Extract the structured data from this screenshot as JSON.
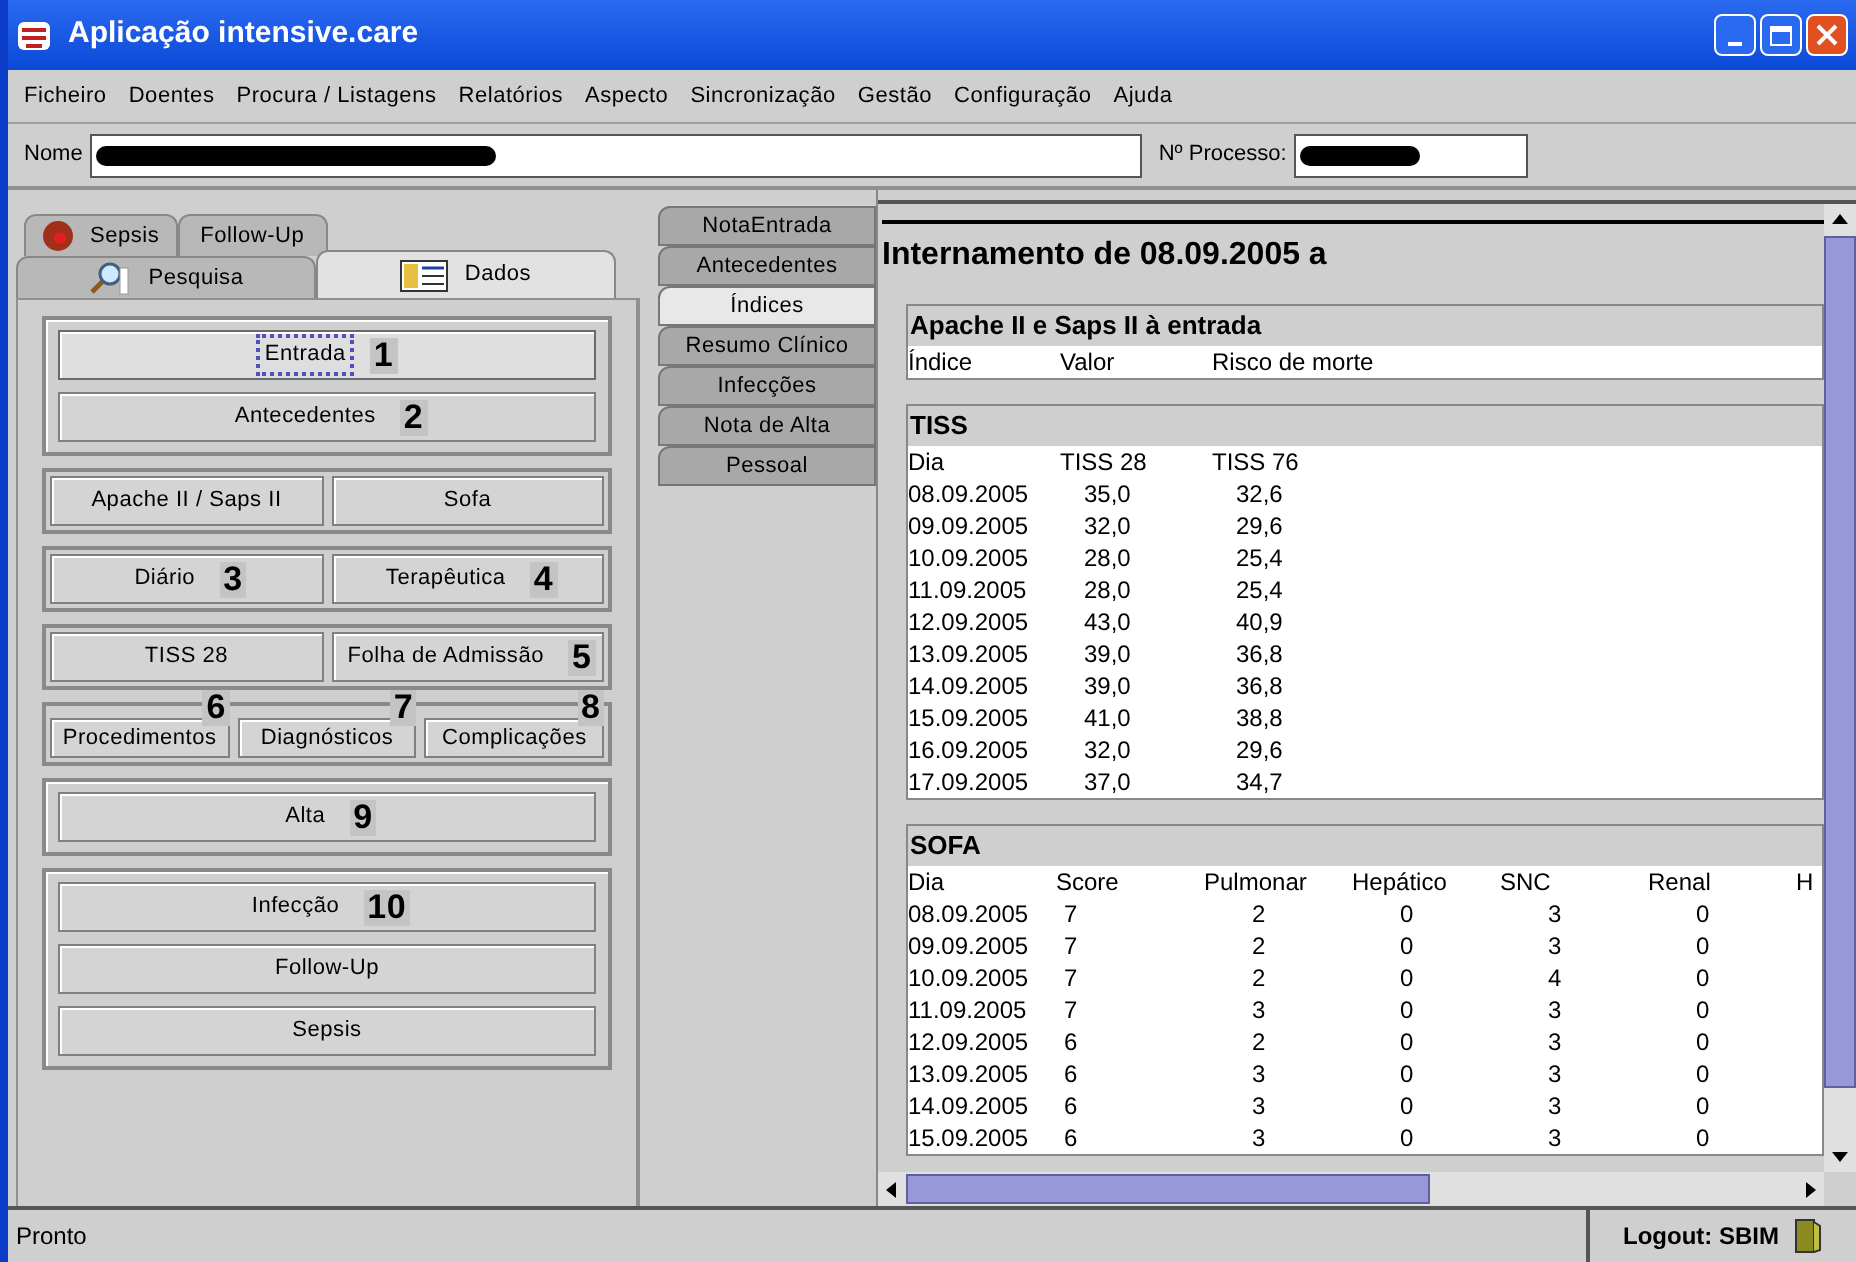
{
  "window": {
    "title": "Aplicação intensive.care"
  },
  "menu": [
    "Ficheiro",
    "Doentes",
    "Procura / Listagens",
    "Relatórios",
    "Aspecto",
    "Sincronização",
    "Gestão",
    "Configuração",
    "Ajuda"
  ],
  "patient": {
    "name_label": "Nome",
    "process_label": "Nº Processo:"
  },
  "left_tabs": [
    [
      {
        "label": "Sepsis",
        "kind": "sepsis",
        "selected": false
      },
      {
        "label": "Follow-Up",
        "kind": "plain",
        "selected": false
      }
    ],
    [
      {
        "label": "Pesquisa",
        "kind": "search",
        "selected": false
      },
      {
        "label": "Dados",
        "kind": "record",
        "selected": true
      }
    ]
  ],
  "button_groups": [
    {
      "kind": "stack",
      "buttons": [
        {
          "label": "Entrada",
          "number": "1",
          "focused": true
        },
        {
          "label": "Antecedentes",
          "number": "2",
          "focused": false
        }
      ]
    },
    {
      "kind": "row",
      "buttons": [
        {
          "label": "Apache II / Saps II",
          "focused": false
        },
        {
          "label": "Sofa",
          "focused": false
        }
      ]
    },
    {
      "kind": "row",
      "buttons": [
        {
          "label": "Diário",
          "number": "3",
          "focused": false
        },
        {
          "label": "Terapêutica",
          "number": "4",
          "focused": false
        }
      ]
    },
    {
      "kind": "row",
      "buttons": [
        {
          "label": "TISS 28",
          "focused": false
        },
        {
          "label": "Folha de Admissão",
          "number": "5",
          "focused": false
        }
      ]
    },
    {
      "kind": "corner",
      "buttons": [
        {
          "label": "Procedimentos",
          "number": "6",
          "focused": false
        },
        {
          "label": "Diagnósticos",
          "number": "7",
          "focused": false
        },
        {
          "label": "Complicações",
          "number": "8",
          "focused": false
        }
      ]
    },
    {
      "kind": "stack",
      "buttons": [
        {
          "label": "Alta",
          "number": "9",
          "focused": false
        }
      ]
    },
    {
      "kind": "stack",
      "buttons": [
        {
          "label": "Infecção",
          "number": "10",
          "focused": false
        },
        {
          "label": "Follow-Up",
          "focused": false
        },
        {
          "label": "Sepsis",
          "focused": false
        }
      ]
    }
  ],
  "vertical_tabs": [
    {
      "label": "NotaEntrada",
      "selected": false
    },
    {
      "label": "Antecedentes",
      "selected": false
    },
    {
      "label": "Índices",
      "selected": true
    },
    {
      "label": "Resumo Clínico",
      "selected": false
    },
    {
      "label": "Infecções",
      "selected": false
    },
    {
      "label": "Nota de Alta",
      "selected": false
    },
    {
      "label": "Pessoal",
      "selected": false
    }
  ],
  "report": {
    "heading": "Internamento de 08.09.2005 a",
    "sections": [
      {
        "title": "Apache II e Saps II à entrada",
        "columns": [
          "Índice",
          "Valor",
          "Risco de morte"
        ]
      },
      {
        "title": "TISS",
        "columns": [
          "Dia",
          "TISS 28",
          "TISS 76"
        ],
        "rows": [
          [
            "08.09.2005",
            "35,0",
            "32,6"
          ],
          [
            "09.09.2005",
            "32,0",
            "29,6"
          ],
          [
            "10.09.2005",
            "28,0",
            "25,4"
          ],
          [
            "11.09.2005",
            "28,0",
            "25,4"
          ],
          [
            "12.09.2005",
            "43,0",
            "40,9"
          ],
          [
            "13.09.2005",
            "39,0",
            "36,8"
          ],
          [
            "14.09.2005",
            "39,0",
            "36,8"
          ],
          [
            "15.09.2005",
            "41,0",
            "38,8"
          ],
          [
            "16.09.2005",
            "32,0",
            "29,6"
          ],
          [
            "17.09.2005",
            "37,0",
            "34,7"
          ]
        ]
      },
      {
        "title": "SOFA",
        "columns": [
          "Dia",
          "Score",
          "Pulmonar",
          "Hepático",
          "SNC",
          "Renal",
          "H"
        ],
        "rows": [
          [
            "08.09.2005",
            "7",
            "2",
            "0",
            "3",
            "0"
          ],
          [
            "09.09.2005",
            "7",
            "2",
            "0",
            "3",
            "0"
          ],
          [
            "10.09.2005",
            "7",
            "2",
            "0",
            "4",
            "0"
          ],
          [
            "11.09.2005",
            "7",
            "3",
            "0",
            "3",
            "0"
          ],
          [
            "12.09.2005",
            "6",
            "2",
            "0",
            "3",
            "0"
          ],
          [
            "13.09.2005",
            "6",
            "3",
            "0",
            "3",
            "0"
          ],
          [
            "14.09.2005",
            "6",
            "3",
            "0",
            "3",
            "0"
          ],
          [
            "15.09.2005",
            "6",
            "3",
            "0",
            "3",
            "0"
          ]
        ]
      }
    ]
  },
  "status_bar": {
    "text": "Pronto",
    "logout": "Logout: SBIM"
  }
}
